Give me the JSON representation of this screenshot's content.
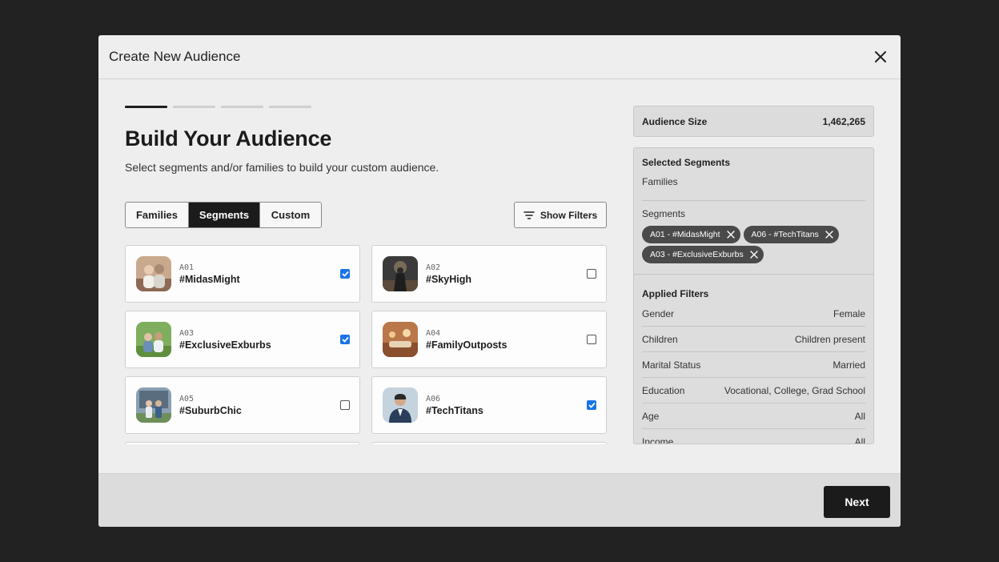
{
  "modal": {
    "title": "Create New Audience"
  },
  "heading": "Build Your Audience",
  "subtext": "Select segments and/or families to build your custom audience.",
  "tabs": [
    {
      "label": "Families",
      "active": false
    },
    {
      "label": "Segments",
      "active": true
    },
    {
      "label": "Custom",
      "active": false
    }
  ],
  "show_filters_label": "Show Filters",
  "segments": [
    {
      "code": "A01",
      "name": "#MidasMight",
      "checked": true
    },
    {
      "code": "A02",
      "name": "#SkyHigh",
      "checked": false
    },
    {
      "code": "A03",
      "name": "#ExclusiveExburbs",
      "checked": true
    },
    {
      "code": "A04",
      "name": "#FamilyOutposts",
      "checked": false
    },
    {
      "code": "A05",
      "name": "#SuburbChic",
      "checked": false
    },
    {
      "code": "A06",
      "name": "#TechTitans",
      "checked": true
    }
  ],
  "audience_size": {
    "label": "Audience Size",
    "value": "1,462,265"
  },
  "selected": {
    "title": "Selected Segments",
    "families_label": "Families",
    "segments_label": "Segments",
    "chips": [
      "A01 - #MidasMight",
      "A06 - #TechTitans",
      "A03 - #ExclusiveExburbs"
    ]
  },
  "applied_filters": {
    "title": "Applied Filters",
    "rows": [
      {
        "label": "Gender",
        "value": "Female"
      },
      {
        "label": "Children",
        "value": "Children present"
      },
      {
        "label": "Marital Status",
        "value": "Married"
      },
      {
        "label": "Education",
        "value": "Vocational, College, Grad School"
      },
      {
        "label": "Age",
        "value": "All"
      },
      {
        "label": "Income",
        "value": "All"
      }
    ]
  },
  "next_label": "Next",
  "colors": {
    "accent": "#1a73e8",
    "dark": "#1b1b1b",
    "chip": "#4a4a4a"
  }
}
